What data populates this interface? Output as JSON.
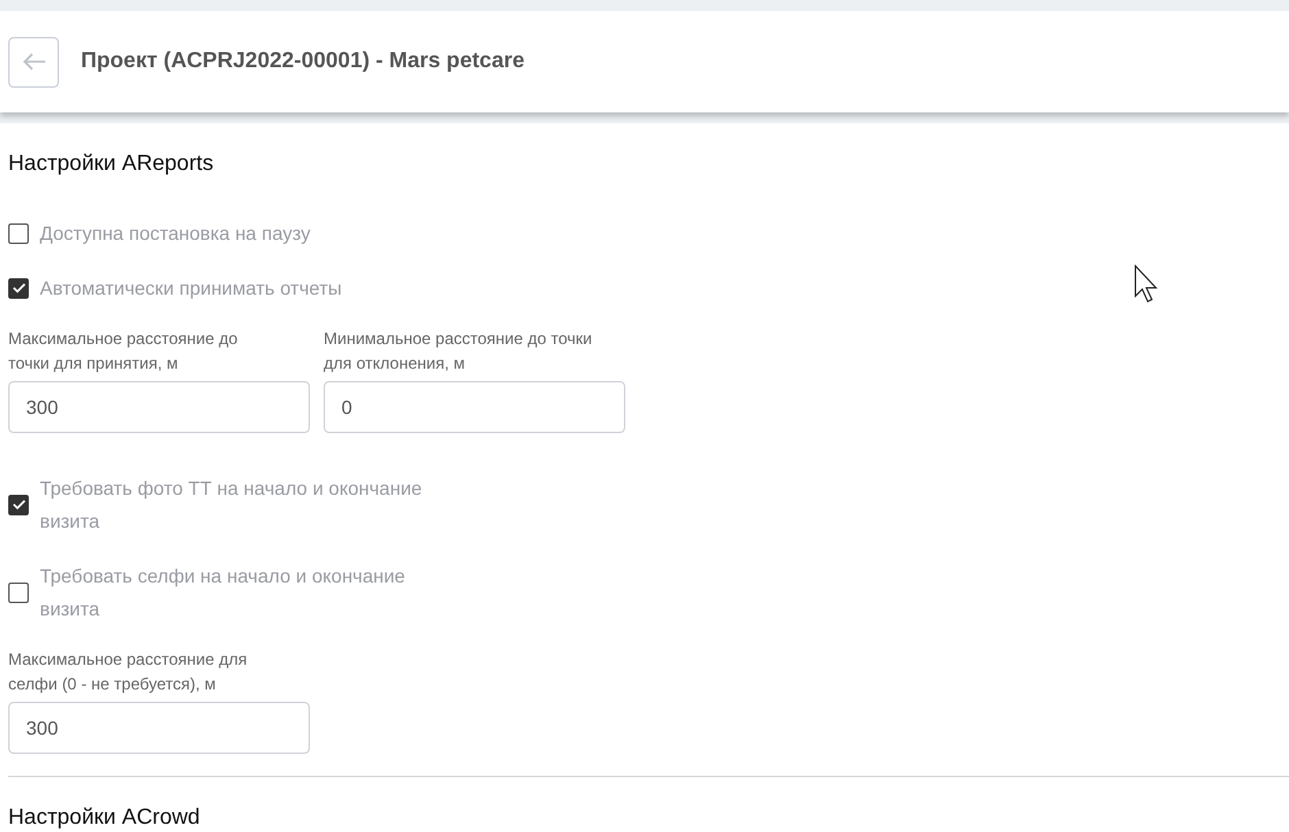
{
  "header": {
    "title": "Проект (ACPRJ2022-00001) - Mars petcare"
  },
  "sections": [
    {
      "title": "Настройки AReports",
      "items": [
        {
          "kind": "checkbox",
          "label": "Доступна постановка на паузу",
          "checked": false
        },
        {
          "kind": "checkbox",
          "label": "Автоматически принимать отчеты",
          "checked": true
        },
        {
          "kind": "fields",
          "fields": [
            {
              "label": "Максимальное расстояние до точки для принятия, м",
              "value": "300"
            },
            {
              "label": "Минимальное расстояние до точки для отклонения, м",
              "value": "0"
            }
          ]
        },
        {
          "kind": "checkbox",
          "label": "Требовать фото ТТ на начало и окончание визита",
          "checked": true
        },
        {
          "kind": "checkbox",
          "label": "Требовать селфи на начало и окончание визита",
          "checked": false
        },
        {
          "kind": "fields",
          "fields": [
            {
              "label": "Максимальное расстояние для селфи (0 - не требуется), м",
              "value": "300"
            }
          ]
        }
      ]
    },
    {
      "title": "Настройки ACrowd"
    }
  ]
}
